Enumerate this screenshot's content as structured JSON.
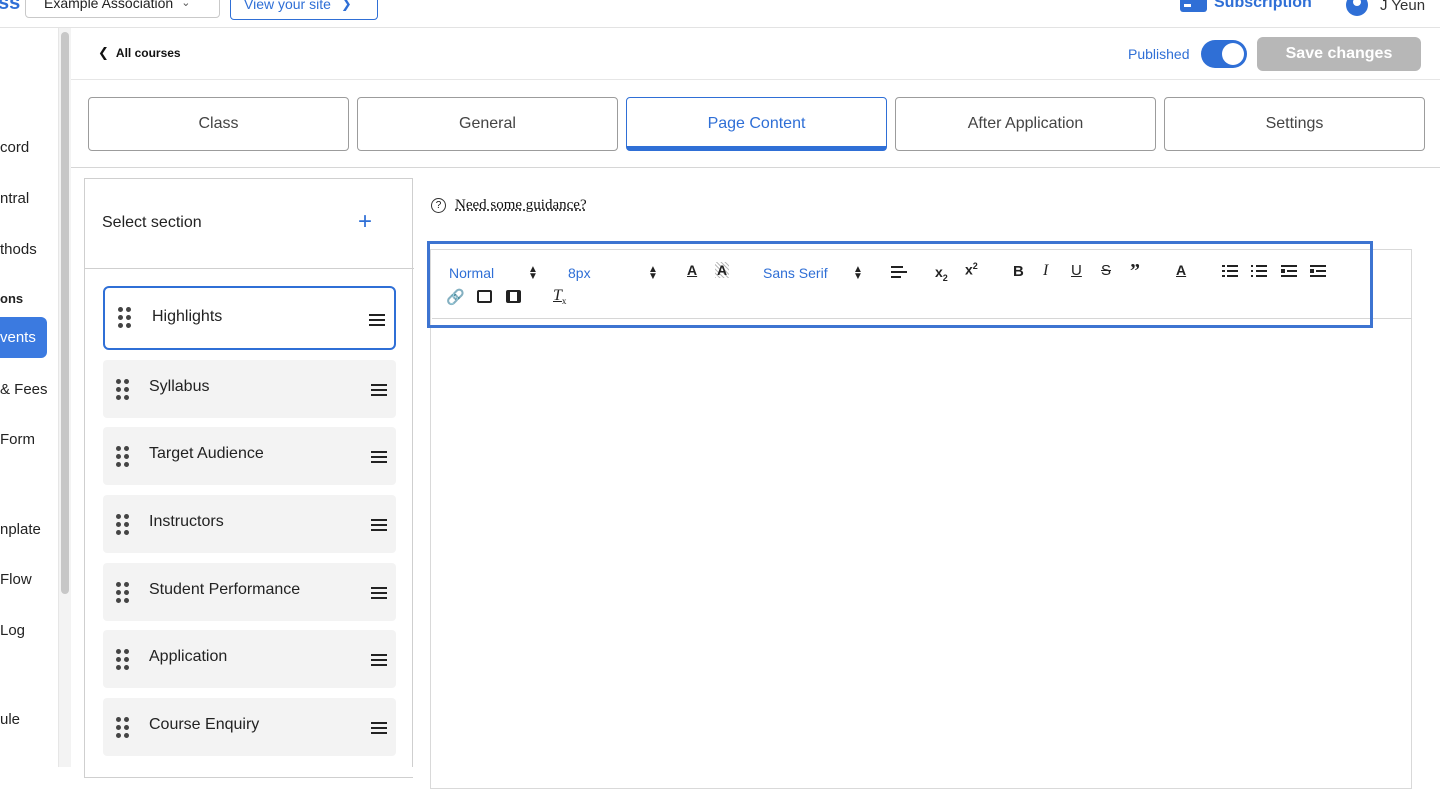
{
  "topbar": {
    "brand": "ss",
    "org_select": "Example Association",
    "view_site": "View your site",
    "subscription": "Subscription",
    "user": "J Yeun"
  },
  "leftnav": {
    "items": [
      "cord",
      "ntral",
      "thods",
      "ons",
      "vents",
      "& Fees",
      "Form",
      "nplate",
      "Flow",
      "Log",
      "ule"
    ]
  },
  "header": {
    "back": "All courses",
    "published_label": "Published",
    "published": true,
    "save_label": "Save changes"
  },
  "tabs": [
    {
      "label": "Class"
    },
    {
      "label": "General"
    },
    {
      "label": "Page Content"
    },
    {
      "label": "After Application"
    },
    {
      "label": "Settings"
    }
  ],
  "sections": {
    "title": "Select section",
    "items": [
      {
        "label": "Highlights"
      },
      {
        "label": "Syllabus"
      },
      {
        "label": "Target Audience"
      },
      {
        "label": "Instructors"
      },
      {
        "label": "Student Performance"
      },
      {
        "label": "Application"
      },
      {
        "label": "Course Enquiry"
      }
    ]
  },
  "editor": {
    "guidance": "Need some guidance?",
    "toolbar": {
      "format": "Normal",
      "size": "8px",
      "font": "Sans Serif"
    }
  },
  "colors": {
    "accent": "#2f6fd6",
    "save_disabled": "#b7b7b7"
  }
}
